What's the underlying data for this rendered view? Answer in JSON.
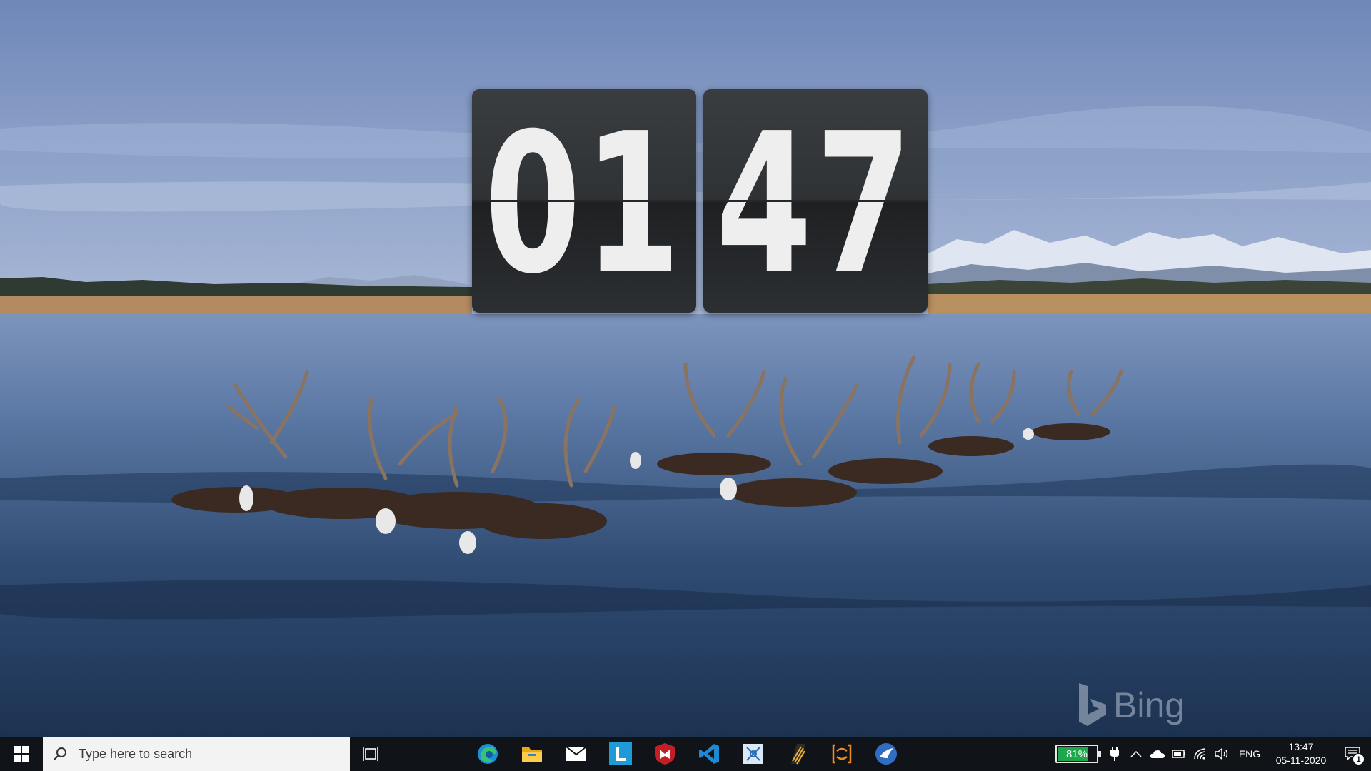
{
  "flip_clock": {
    "hours": "01",
    "minutes": "47"
  },
  "wallpaper": {
    "watermark": "Bing"
  },
  "taskbar": {
    "search_placeholder": "Type here to search",
    "pinned_apps": [
      {
        "name": "Microsoft Edge",
        "icon": "edge-icon"
      },
      {
        "name": "File Explorer",
        "icon": "folder-icon"
      },
      {
        "name": "Mail",
        "icon": "mail-icon"
      },
      {
        "name": "L app",
        "icon": "l-app-icon"
      },
      {
        "name": "McAfee",
        "icon": "mcafee-icon"
      },
      {
        "name": "Visual Studio Code",
        "icon": "vscode-icon"
      },
      {
        "name": "Snipping tool",
        "icon": "snip-icon"
      },
      {
        "name": "Striped app",
        "icon": "striped-app-icon"
      },
      {
        "name": "Bracket app",
        "icon": "bracket-app-icon"
      },
      {
        "name": "Bird app",
        "icon": "bird-app-icon"
      }
    ],
    "tray": {
      "battery_percent": 81,
      "battery_text": "81%",
      "language": "ENG",
      "time": "13:47",
      "date": "05-11-2020",
      "notification_count": "1"
    }
  },
  "colors": {
    "taskbar_bg": "#101317",
    "battery_fill": "#1ea84b",
    "flip_card": "#303336",
    "flip_digit": "#eeeeee"
  }
}
